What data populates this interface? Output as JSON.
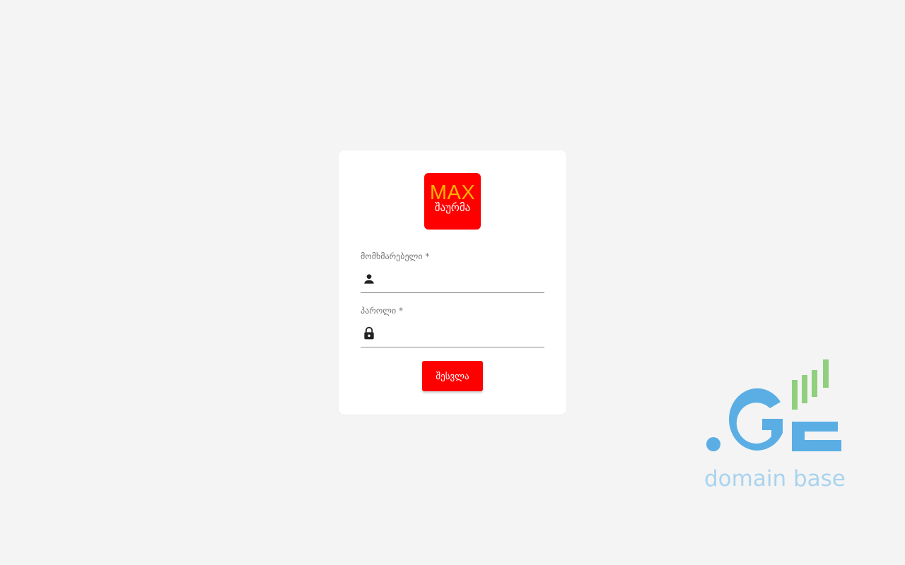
{
  "logo": {
    "top_text": "MAX",
    "bottom_text": "შაურმა",
    "bg_color": "#ff0000",
    "top_text_color": "#ffb400"
  },
  "form": {
    "username": {
      "label": "მომხმარებელი *",
      "value": "",
      "icon": "person-icon"
    },
    "password": {
      "label": "პაროლი *",
      "value": "",
      "icon": "lock-icon"
    },
    "submit_label": "შესვლა",
    "accent_color": "#ff0000"
  },
  "watermark": {
    "logo_text": ".GE",
    "caption": "domain base",
    "primary_color": "#5aaee4",
    "bar_color": "#8fcf7d"
  }
}
